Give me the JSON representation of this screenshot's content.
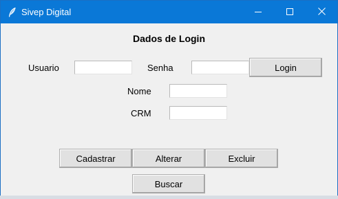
{
  "window": {
    "title": "Sivep Digital",
    "icon": "feather-icon",
    "controls": [
      "minimize-icon",
      "maximize-icon",
      "close-icon"
    ]
  },
  "form": {
    "heading": "Dados de Login",
    "usuario_label": "Usuario",
    "usuario_value": "",
    "senha_label": "Senha",
    "senha_value": "",
    "login_button": "Login",
    "nome_label": "Nome",
    "nome_value": "",
    "crm_label": "CRM",
    "crm_value": ""
  },
  "actions": {
    "cadastrar": "Cadastrar",
    "alterar": "Alterar",
    "excluir": "Excluir",
    "buscar": "Buscar"
  },
  "colors": {
    "titlebar": "#0a78d7",
    "client_bg": "#f0f0f0",
    "button_bg": "#e1e1e1"
  }
}
